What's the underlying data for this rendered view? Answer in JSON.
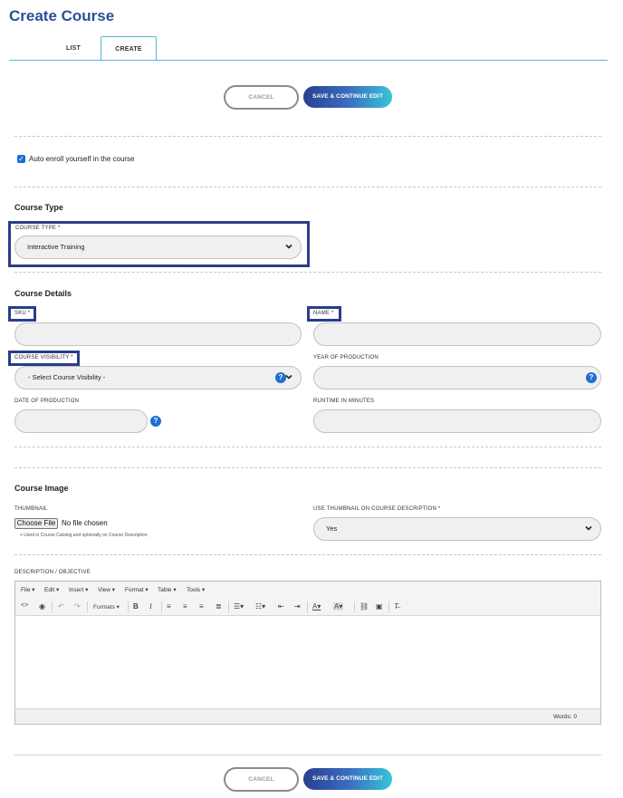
{
  "page": {
    "title": "Create Course"
  },
  "tabs": {
    "list": "LIST",
    "create": "CREATE"
  },
  "actions": {
    "cancel": "CANCEL",
    "save": "SAVE & CONTINUE EDIT"
  },
  "auto_enroll": {
    "label": "Auto enroll yourself in the course",
    "checked": true
  },
  "course_type": {
    "heading": "Course Type",
    "label": "COURSE TYPE *",
    "value": "Interactive Training"
  },
  "course_details": {
    "heading": "Course Details",
    "sku_label": "SKU *",
    "name_label": "NAME *",
    "visibility_label": "COURSE VISIBILITY *",
    "visibility_value": "- Select Course Visibility -",
    "year_label": "YEAR OF PRODUCTION",
    "date_label": "DATE OF PRODUCTION",
    "runtime_label": "RUNTIME IN MINUTES",
    "help_glyph": "?"
  },
  "course_image": {
    "heading": "Course Image",
    "thumbnail_label": "THUMBNAIL",
    "choose_file": "Choose File",
    "no_file": "No file chosen",
    "hint": "+ Used in Course Catalog and optionally on Course Description.",
    "use_thumb_label": "USE THUMBNAIL ON COURSE DESCRIPTION *",
    "use_thumb_value": "Yes"
  },
  "description": {
    "label": "DESCRIPTION / OBJECTIVE",
    "menu": [
      "File",
      "Edit",
      "Insert",
      "View",
      "Format",
      "Table",
      "Tools"
    ],
    "formats": "Formats",
    "words": "Words: 0"
  },
  "colors": {
    "brand": "#2c4d9c",
    "highlight": "#2a3c8c",
    "tab_line": "#5ab4d8",
    "help": "#1e6fd0"
  }
}
